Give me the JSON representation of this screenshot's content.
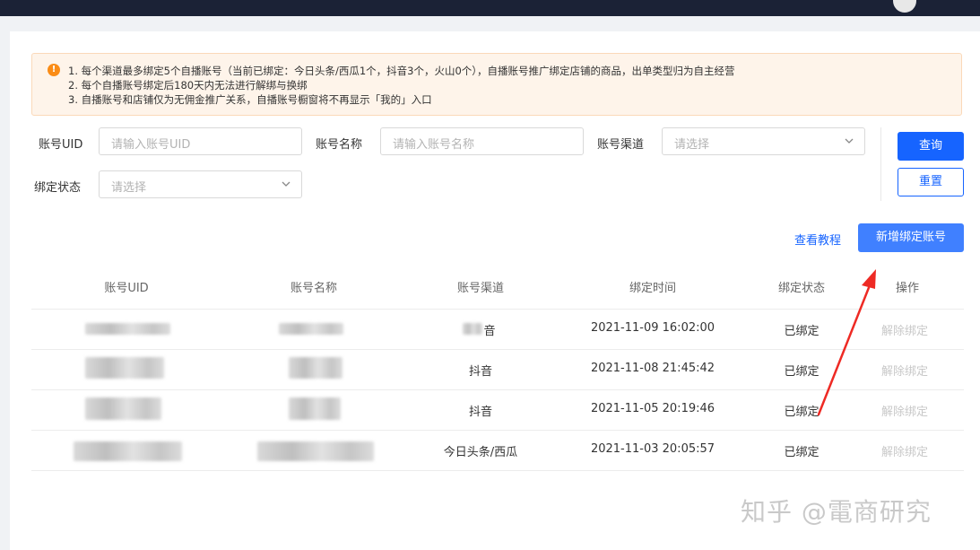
{
  "notice": {
    "lines": [
      "1. 每个渠道最多绑定5个自播账号（当前已绑定：今日头条/西瓜1个，抖音3个，火山0个），自播账号推广绑定店铺的商品，出单类型归为自主经营",
      "2. 每个自播账号绑定后180天内无法进行解绑与换绑",
      "3. 自播账号和店铺仅为无佣金推广关系，自播账号橱窗将不再显示「我的」入口"
    ],
    "icon": "warning-icon",
    "color": "#fa8c16"
  },
  "filters": {
    "uid_label": "账号UID",
    "uid_placeholder": "请输入账号UID",
    "name_label": "账号名称",
    "name_placeholder": "请输入账号名称",
    "channel_label": "账号渠道",
    "channel_placeholder": "请选择",
    "status_label": "绑定状态",
    "status_placeholder": "请选择"
  },
  "buttons": {
    "query": "查询",
    "reset": "重置",
    "tutorial": "查看教程",
    "add": "新增绑定账号"
  },
  "table": {
    "headers": [
      "账号UID",
      "账号名称",
      "账号渠道",
      "绑定时间",
      "绑定状态",
      "操作"
    ],
    "rows": [
      {
        "channel": "音",
        "time": "2021-11-09 16:02:00",
        "status": "已绑定",
        "action": "解除绑定"
      },
      {
        "channel": "抖音",
        "time": "2021-11-08 21:45:42",
        "status": "已绑定",
        "action": "解除绑定"
      },
      {
        "channel": "抖音",
        "time": "2021-11-05 20:19:46",
        "status": "已绑定",
        "action": "解除绑定"
      },
      {
        "channel": "今日头条/西瓜",
        "time": "2021-11-03 20:05:57",
        "status": "已绑定",
        "action": "解除绑定"
      }
    ]
  },
  "watermark": "知乎 @電商研究",
  "colors": {
    "primary": "#1664ff",
    "topbar": "#1b2236",
    "annotation_arrow": "#ee2a24"
  }
}
